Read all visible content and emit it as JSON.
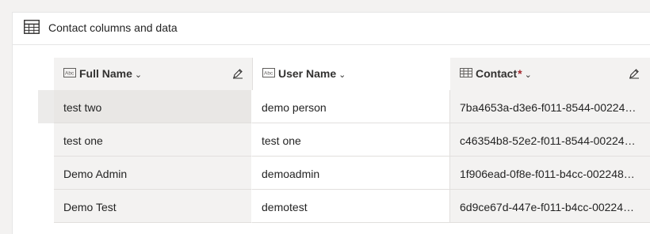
{
  "section": {
    "title": "Contact columns and data"
  },
  "columns": [
    {
      "label": "Full Name",
      "icon": "text-field-icon",
      "required": false,
      "editable": true
    },
    {
      "label": "User Name",
      "icon": "text-field-icon",
      "required": false,
      "editable": false
    },
    {
      "label": "Contact",
      "icon": "lookup-field-icon",
      "required": true,
      "required_marker": "*",
      "editable": true
    }
  ],
  "chevron": "⌄",
  "rows": [
    {
      "full_name": "test two",
      "user_name": "demo person",
      "contact": "7ba4653a-d3e6-f011-8544-00224…"
    },
    {
      "full_name": "test one",
      "user_name": "test one",
      "contact": "c46354b8-52e2-f011-8544-00224…"
    },
    {
      "full_name": "Demo Admin",
      "user_name": "demoadmin",
      "contact": "1f906ead-0f8e-f011-b4cc-002248…"
    },
    {
      "full_name": "Demo Test",
      "user_name": "demotest",
      "contact": "6d9ce67d-447e-f011-b4cc-00224…"
    }
  ],
  "colors": {
    "accent_required": "#a4262c",
    "header_bg": "#f3f2f1",
    "text": "#242424"
  }
}
